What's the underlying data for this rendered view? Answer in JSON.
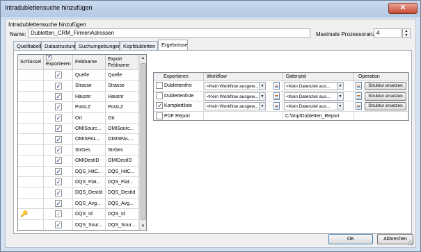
{
  "window": {
    "title": "Intradublettensuche hinzufügen",
    "close_label": "✕"
  },
  "group_title": "Intradublettensuche hinzufügen",
  "name": {
    "label": "Name:",
    "value": "Dubletten_CRM_FirmenAdressen"
  },
  "max_proc": {
    "label": "Maximale Prozessoranzahl",
    "value": "4"
  },
  "tabs": [
    "Quelltabellen",
    "Datastructure",
    "Suchumgebungen",
    "Kopfdubletten",
    "Ergebnisse"
  ],
  "left_grid": {
    "headers": {
      "key": "Schlüssel",
      "export": "Exportieren",
      "field": "Feldname",
      "export_field": "Export Feldname"
    },
    "rows": [
      {
        "key": "",
        "checked": true,
        "field": "Quelle",
        "export_field": "Quelle"
      },
      {
        "key": "",
        "checked": true,
        "field": "Strasse",
        "export_field": "Strasse"
      },
      {
        "key": "",
        "checked": true,
        "field": "Hausnr",
        "export_field": "Hausnr"
      },
      {
        "key": "",
        "checked": true,
        "field": "PostLZ",
        "export_field": "PostLZ"
      },
      {
        "key": "",
        "checked": true,
        "field": "Ort",
        "export_field": "Ort"
      },
      {
        "key": "",
        "checked": true,
        "field": "OMISourc...",
        "export_field": "OMISourc..."
      },
      {
        "key": "",
        "checked": true,
        "field": "OMISPAL...",
        "export_field": "OMISPAL..."
      },
      {
        "key": "",
        "checked": true,
        "field": "StrGes",
        "export_field": "StrGes"
      },
      {
        "key": "",
        "checked": true,
        "field": "OMIDestID",
        "export_field": "OMIDestID"
      },
      {
        "key": "",
        "checked": true,
        "field": "DQS_HitC...",
        "export_field": "DQS_HitC..."
      },
      {
        "key": "",
        "checked": true,
        "field": "DQS_Flat...",
        "export_field": "DQS_Flat..."
      },
      {
        "key": "",
        "checked": true,
        "field": "DQS_DestId",
        "export_field": "DQS_DestId"
      },
      {
        "key": "",
        "checked": true,
        "field": "DQS_Avg...",
        "export_field": "DQS_Avg..."
      },
      {
        "key": "key-icon",
        "checked": true,
        "gray": true,
        "field": "DQS_Id",
        "export_field": "DQS_Id"
      },
      {
        "key": "",
        "checked": true,
        "field": "DQS_Sour...",
        "export_field": "DQS_Sour..."
      }
    ]
  },
  "right_grid": {
    "headers": {
      "export": "Exportieren",
      "workflow": "Workflow",
      "target": "Datenziel",
      "operation": "Operation"
    },
    "rows": [
      {
        "checked": false,
        "name": "Dublettenfrei",
        "workflow": "<Kein Workflow ausgew...",
        "target": "<Kein Datenziel aus...",
        "op": "Struktur ersetzen"
      },
      {
        "checked": false,
        "name": "Dublettenliste",
        "workflow": "<Kein Workflow ausgew...",
        "target": "<Kein Datenziel aus...",
        "op": "Struktur ersetzen"
      },
      {
        "checked": true,
        "name": "Komplettliste",
        "workflow": "<Kein Workflow ausgew...",
        "target": "<Kein Datenziel aus...",
        "op": "Struktur ersetzen"
      },
      {
        "checked": false,
        "name": "PDF Report",
        "workflow": "",
        "target": "C:\\tmp\\Dubletten_Report",
        "op": ""
      }
    ]
  },
  "buttons": {
    "ok": "OK",
    "cancel": "Abbrechen"
  }
}
